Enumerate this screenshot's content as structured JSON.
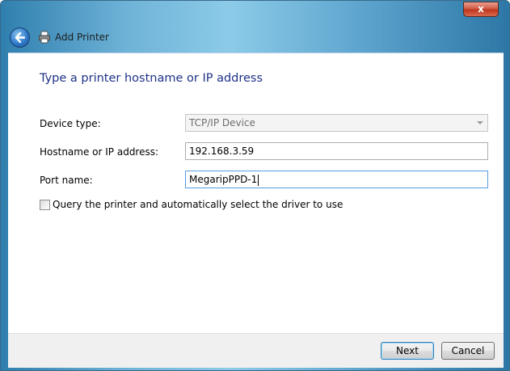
{
  "window": {
    "title": "Add Printer",
    "close_label": "x"
  },
  "main": {
    "heading": "Type a printer hostname or IP address",
    "device_type": {
      "label": "Device type:",
      "value": "TCP/IP Device"
    },
    "hostname": {
      "label": "Hostname or IP address:",
      "value": "192.168.3.59"
    },
    "port": {
      "label": "Port name:",
      "value": "MegaripPPD-1"
    },
    "query": {
      "label": "Query the printer and automatically select the driver to use",
      "checked": false
    }
  },
  "footer": {
    "next_label": "Next",
    "cancel_label": "Cancel"
  },
  "icons": [
    "back-arrow-icon",
    "printer-icon",
    "close-icon",
    "dropdown-arrow-icon"
  ]
}
